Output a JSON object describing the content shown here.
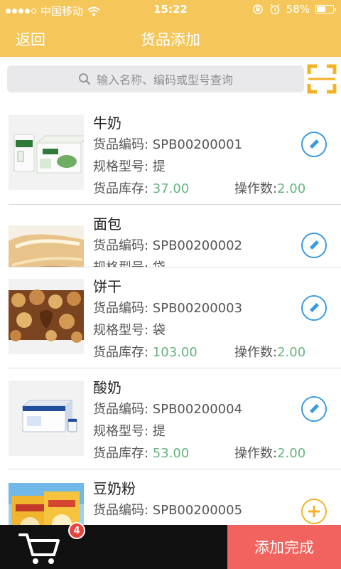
{
  "status_bar": {
    "carrier": "中国移动",
    "time": "15:22",
    "battery": "58%",
    "battery_level": 0.58,
    "icons": [
      "signal-dots-icon",
      "wifi-icon",
      "rotation-lock-icon",
      "alarm-icon",
      "battery-icon"
    ]
  },
  "nav": {
    "back_label": "返回",
    "title": "货品添加"
  },
  "search": {
    "placeholder": "输入名称、编码或型号查询",
    "icon": "search-icon",
    "scan_icon": "qr-scan-icon"
  },
  "labels": {
    "code": "货品编码: ",
    "spec": "规格型号: ",
    "stock": "货品库存: ",
    "ops": "操作数:"
  },
  "products": [
    {
      "name": "牛奶",
      "code": "SPB00200001",
      "spec": "提",
      "stock": "37.00",
      "ops": "2.00",
      "action": "edit",
      "image": "milk-box-image"
    },
    {
      "name": "面包",
      "code": "SPB00200002",
      "spec": "袋",
      "stock": "",
      "ops": "",
      "action": "edit",
      "image": "bread-image"
    },
    {
      "name": "饼干",
      "code": "SPB00200003",
      "spec": "袋",
      "stock": "103.00",
      "ops": "2.00",
      "action": "edit",
      "image": "biscuits-image"
    },
    {
      "name": "酸奶",
      "code": "SPB00200004",
      "spec": "提",
      "stock": "53.00",
      "ops": "2.00",
      "action": "edit",
      "image": "yogurt-box-image"
    },
    {
      "name": "豆奶粉",
      "code": "SPB00200005",
      "spec": "",
      "stock": "",
      "ops": "",
      "action": "add",
      "image": "soy-milk-powder-image"
    }
  ],
  "bottom_bar": {
    "cart_icon": "shopping-cart-icon",
    "cart_count": "4",
    "done_label": "添加完成"
  },
  "colors": {
    "brand": "#f5c75b",
    "edit": "#3a9be0",
    "add": "#f3b325",
    "stock_value": "#66b47f",
    "done": "#f0635e",
    "badge": "#e8453c"
  }
}
